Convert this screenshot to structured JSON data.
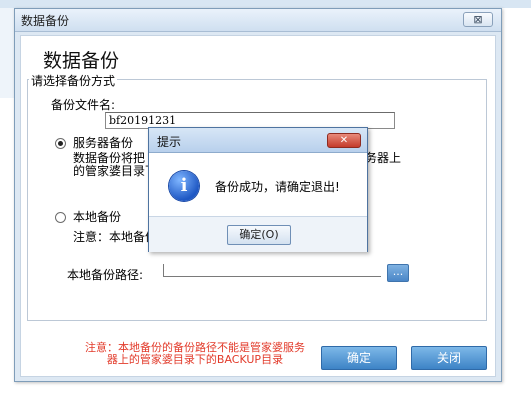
{
  "main_dialog": {
    "title": "数据备份",
    "close_glyph": "⊠",
    "heading": "数据备份",
    "group_label": "请选择备份方式",
    "backup_filename_label": "备份文件名:",
    "backup_filename_value": "bf20191231",
    "server_option": {
      "label": "服务器备份",
      "checked": true,
      "desc_line1_left": "数据备份将把",
      "desc_line2_left": "的管家婆目录下",
      "desc_line1_right": "务器上"
    },
    "local_option": {
      "label": "本地备份",
      "checked": false,
      "note_left": "注意：本地备份"
    },
    "local_path_label": "本地备份路径:",
    "browse_label": "...",
    "warning_line1": "注意：本地备份的备份路径不能是管家婆服务",
    "warning_line2": "器上的管家婆目录下的BACKUP目录",
    "ok_label": "确定",
    "close_label": "关闭"
  },
  "prompt_dialog": {
    "title": "提示",
    "close_glyph": "✕",
    "icon": "info-icon",
    "icon_glyph": "i",
    "message": "备份成功，请确定退出!",
    "ok_label": "确定(O)"
  },
  "colors": {
    "accent_button": "#3d83c6",
    "warning_text": "#e23a2a",
    "prompt_close": "#c43b2b",
    "info_icon": "#1f58c4"
  }
}
